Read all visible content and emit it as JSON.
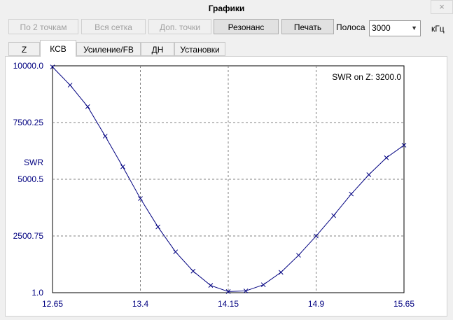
{
  "window": {
    "title": "Графики",
    "close_label": "×"
  },
  "toolbar": {
    "buttons": [
      {
        "label": "По 2 точкам",
        "enabled": false
      },
      {
        "label": "Вся сетка",
        "enabled": false
      },
      {
        "label": "Доп. точки",
        "enabled": false
      },
      {
        "label": "Резонанс",
        "enabled": true
      },
      {
        "label": "Печать",
        "enabled": true
      }
    ],
    "band_label": "Полоса",
    "band_value": "3000",
    "band_unit": "кГц"
  },
  "tabs": [
    {
      "label": "Z",
      "selected": false
    },
    {
      "label": "КСВ",
      "selected": true
    },
    {
      "label": "Усиление/FB",
      "selected": false
    },
    {
      "label": "ДН",
      "selected": false
    },
    {
      "label": "Установки",
      "selected": false
    }
  ],
  "chart_data": {
    "type": "line",
    "ylabel": "SWR",
    "annotation": "SWR on Z: 3200.0",
    "x_ticks": [
      "12.65",
      "13.4",
      "14.15",
      "14.9",
      "15.65"
    ],
    "y_ticks": [
      "10000.0",
      "7500.25",
      "5000.5",
      "2500.75",
      "1.0"
    ],
    "xlim": [
      12.65,
      15.65
    ],
    "ylim": [
      1.0,
      10000.0
    ],
    "grid": true,
    "colors": {
      "line": "#000080",
      "grid": "#808080",
      "text": "#000080"
    },
    "series": [
      {
        "x": [
          12.65,
          12.8,
          12.95,
          13.1,
          13.25,
          13.4,
          13.55,
          13.7,
          13.85,
          14.0,
          14.15,
          14.3,
          14.45,
          14.6,
          14.75,
          14.9,
          15.05,
          15.2,
          15.35,
          15.5,
          15.65
        ],
        "y": [
          9950,
          9150,
          8200,
          6900,
          5550,
          4150,
          2900,
          1800,
          950,
          320,
          50,
          80,
          350,
          900,
          1650,
          2500,
          3400,
          4350,
          5200,
          5950,
          6500
        ]
      }
    ]
  }
}
